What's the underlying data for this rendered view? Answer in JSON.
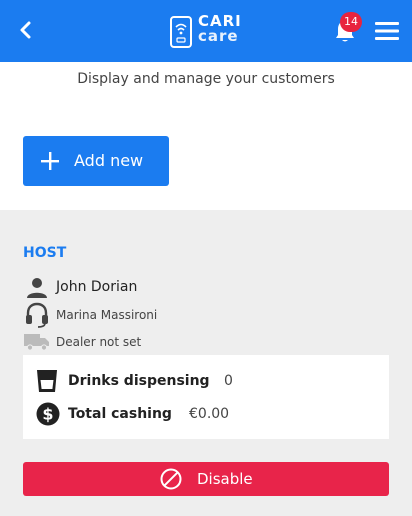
{
  "header": {
    "logo_line1": "CARI",
    "logo_line2": "care",
    "notification_count": "14",
    "colors": {
      "primary": "#1b7cf0",
      "badge": "#e8243e"
    },
    "icons": [
      "back-arrow-icon",
      "logo-phone-icon",
      "bell-icon",
      "hamburger-menu-icon"
    ]
  },
  "page": {
    "subtitle": "Display and manage your customers",
    "add_button_label": "Add new"
  },
  "customer": {
    "section_label": "HOST",
    "name": "John Dorian",
    "operator": "Marina Massironi",
    "dealer": "Dealer not set",
    "stats": {
      "drinks_label": "Drinks dispensing",
      "drinks_value": "0",
      "cashing_label": "Total cashing",
      "cashing_value": "€0.00"
    },
    "disable_label": "Disable",
    "disable_color": "#e8244a"
  }
}
